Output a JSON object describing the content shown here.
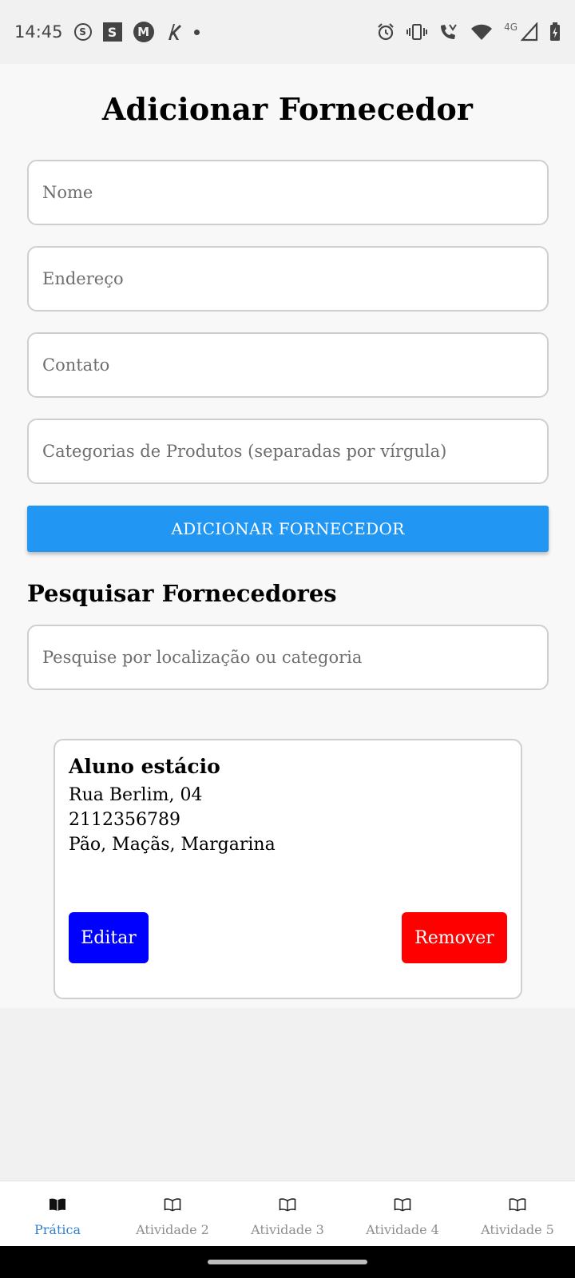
{
  "status_bar": {
    "time": "14:45",
    "left_icons": [
      "s-circle-icon",
      "s-square-icon",
      "motorola-icon",
      "k-icon",
      "dot-icon"
    ],
    "right_icons": [
      "alarm-icon",
      "vibrate-icon",
      "wifi-calling-icon",
      "wifi-icon",
      "signal-icon",
      "battery-icon"
    ],
    "network": "4G",
    "s_circle": "S",
    "s_square": "S",
    "m_badge": "M"
  },
  "page": {
    "title": "Adicionar Fornecedor"
  },
  "form": {
    "name_placeholder": "Nome",
    "address_placeholder": "Endereço",
    "contact_placeholder": "Contato",
    "categories_placeholder": "Categorias de Produtos (separadas por vírgula)",
    "submit_label": "ADICIONAR FORNECEDOR"
  },
  "search": {
    "title": "Pesquisar Fornecedores",
    "placeholder": "Pesquise por localização ou categoria"
  },
  "suppliers": [
    {
      "name": "Aluno estácio",
      "address": "Rua Berlim, 04",
      "contact": "2112356789",
      "categories": "Pão, Maçãs, Margarina",
      "edit_label": "Editar",
      "remove_label": "Remover"
    }
  ],
  "tabs": [
    {
      "label": "Prática",
      "icon": "book-open-icon",
      "active": true
    },
    {
      "label": "Atividade 2",
      "icon": "book-open-icon",
      "active": false
    },
    {
      "label": "Atividade 3",
      "icon": "book-open-icon",
      "active": false
    },
    {
      "label": "Atividade 4",
      "icon": "book-open-icon",
      "active": false
    },
    {
      "label": "Atividade 5",
      "icon": "book-open-icon",
      "active": false
    }
  ],
  "colors": {
    "primary_button": "#2196f3",
    "edit_button": "#0000ff",
    "remove_button": "#ff0000",
    "active_tab": "#2f7fcf",
    "inactive_tab": "#8e8e8e"
  }
}
